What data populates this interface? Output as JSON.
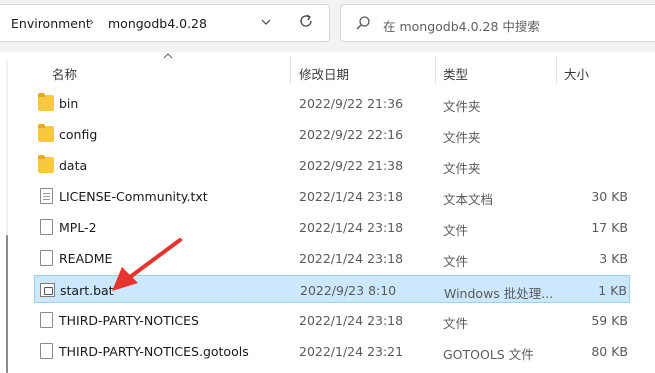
{
  "address_bar": {
    "crumbs": [
      "Environment",
      "mongodb4.0.28"
    ],
    "separator": "›",
    "dropdown_icon": "chevron-down-icon",
    "refresh_icon": "refresh-icon"
  },
  "search": {
    "placeholder": "在 mongodb4.0.28 中搜索",
    "icon": "search-icon"
  },
  "columns": {
    "name": "名称",
    "date": "修改日期",
    "type": "类型",
    "size": "大小"
  },
  "files": [
    {
      "name": "bin",
      "date": "2022/9/22 21:36",
      "type": "文件夹",
      "size": "",
      "icon": "folder-icon"
    },
    {
      "name": "config",
      "date": "2022/9/22 22:16",
      "type": "文件夹",
      "size": "",
      "icon": "folder-icon"
    },
    {
      "name": "data",
      "date": "2022/9/22 21:38",
      "type": "文件夹",
      "size": "",
      "icon": "folder-icon"
    },
    {
      "name": "LICENSE-Community.txt",
      "date": "2022/1/24 23:18",
      "type": "文本文档",
      "size": "30 KB",
      "icon": "text-file-icon"
    },
    {
      "name": "MPL-2",
      "date": "2022/1/24 23:18",
      "type": "文件",
      "size": "17 KB",
      "icon": "file-icon"
    },
    {
      "name": "README",
      "date": "2022/1/24 23:18",
      "type": "文件",
      "size": "3 KB",
      "icon": "file-icon"
    },
    {
      "name": "start.bat",
      "date": "2022/9/23 8:10",
      "type": "Windows 批处理...",
      "size": "1 KB",
      "icon": "batch-file-icon",
      "selected": true
    },
    {
      "name": "THIRD-PARTY-NOTICES",
      "date": "2022/1/24 23:18",
      "type": "文件",
      "size": "59 KB",
      "icon": "file-icon"
    },
    {
      "name": "THIRD-PARTY-NOTICES.gotools",
      "date": "2022/1/24 23:21",
      "type": "GOTOOLS 文件",
      "size": "80 KB",
      "icon": "file-icon"
    }
  ],
  "colors": {
    "selection_bg": "#cce8ff",
    "selection_border": "#99d1ff",
    "folder": "#f8c843",
    "annotation_arrow": "#e8342e"
  }
}
